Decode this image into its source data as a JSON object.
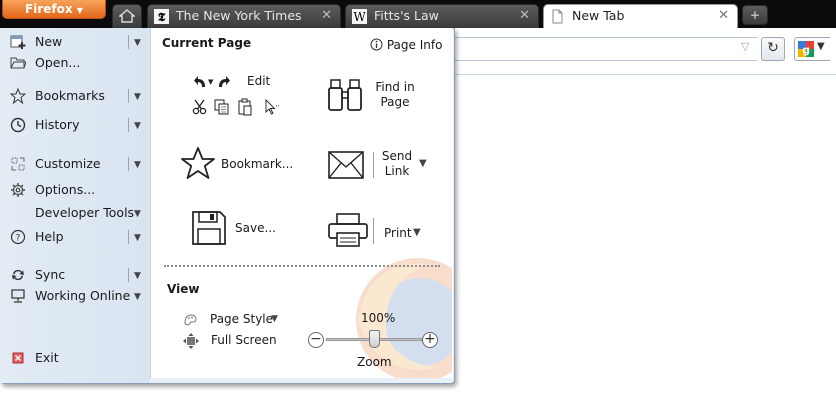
{
  "window": {
    "app_button": "Firefox",
    "tabs": [
      {
        "title": "The New York Times",
        "active": false
      },
      {
        "title": "Fitts's Law",
        "active": false
      },
      {
        "title": "New Tab",
        "active": true
      }
    ],
    "new_tab_glyph": "+"
  },
  "menu": {
    "left": [
      {
        "label": "New",
        "icon": "new-window-icon",
        "submenu": true
      },
      {
        "label": "Open...",
        "icon": "folder-icon",
        "submenu": false
      },
      {
        "label": "Bookmarks",
        "icon": "bookmarks-icon",
        "submenu": true
      },
      {
        "label": "History",
        "icon": "history-clock-icon",
        "submenu": true
      },
      {
        "label": "Customize",
        "icon": "customize-icon",
        "submenu": true
      },
      {
        "label": "Options...",
        "icon": "gear-icon",
        "submenu": false
      },
      {
        "label": "Developer Tools",
        "icon": "",
        "submenu": true
      },
      {
        "label": "Help",
        "icon": "help-icon",
        "submenu": true
      },
      {
        "label": "Sync",
        "icon": "sync-icon",
        "submenu": true
      },
      {
        "label": "Working Online",
        "icon": "computer-icon",
        "submenu": true
      },
      {
        "label": "Exit",
        "icon": "exit-icon",
        "submenu": false
      }
    ],
    "current_page": {
      "title": "Current Page",
      "page_info": "Page Info",
      "edit": "Edit",
      "find": "Find in Page",
      "bookmark": "Bookmark...",
      "send_link": "Send Link",
      "save": "Save...",
      "print": "Print"
    },
    "view": {
      "title": "View",
      "page_style": "Page Style",
      "full_screen": "Full Screen",
      "zoom_level": "100%",
      "zoom_label": "Zoom",
      "zoom_fraction": 0.5
    }
  },
  "colors": {
    "firefox_orange": "#e2661b",
    "menu_background": "#e9f0f7",
    "tabstrip": "#0b0b0b"
  }
}
